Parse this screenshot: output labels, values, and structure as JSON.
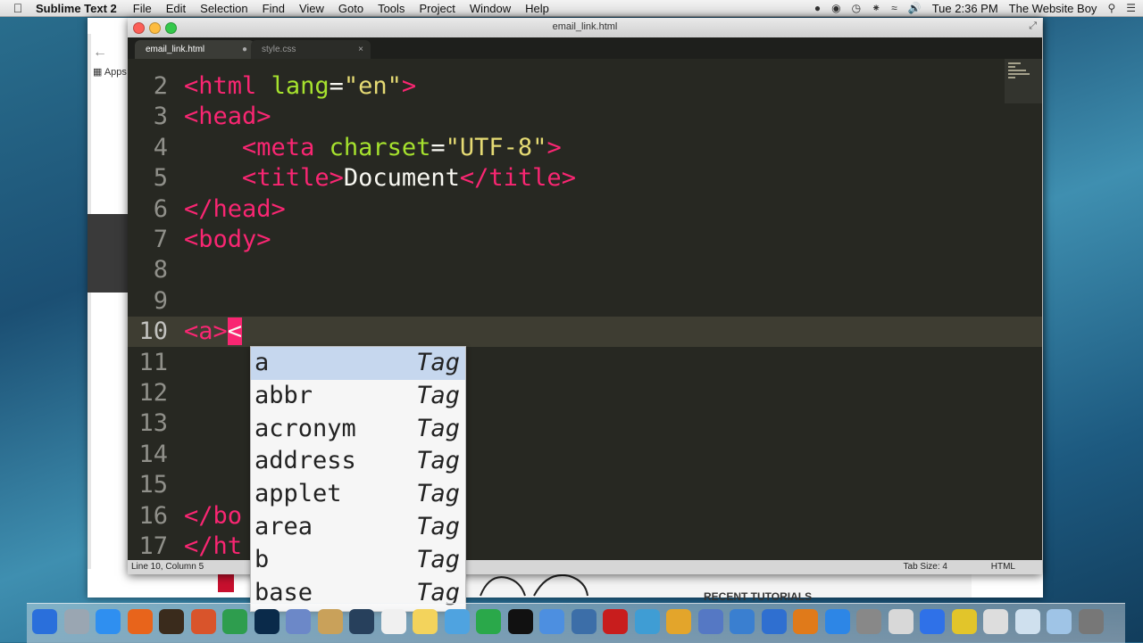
{
  "menubar": {
    "app_name": "Sublime Text 2",
    "menus": [
      "File",
      "Edit",
      "Selection",
      "Find",
      "View",
      "Goto",
      "Tools",
      "Project",
      "Window",
      "Help"
    ],
    "clock": "Tue 2:36 PM",
    "user": "The Website Boy"
  },
  "browser": {
    "apps_label": "Apps",
    "recent_tutorials": "RECENT TUTORIALS"
  },
  "window": {
    "title": "email_link.html"
  },
  "tabs": [
    {
      "label": "email_link.html",
      "active": true
    },
    {
      "label": "style.css",
      "active": false
    }
  ],
  "editor": {
    "lines": [
      {
        "num": "2",
        "tokens": [
          [
            "tag",
            "<"
          ],
          [
            "tag",
            "html"
          ],
          [
            "txt",
            " "
          ],
          [
            "attr",
            "lang"
          ],
          [
            "txt",
            "="
          ],
          [
            "str",
            "\"en\""
          ],
          [
            "tag",
            ">"
          ]
        ]
      },
      {
        "num": "3",
        "tokens": [
          [
            "tag",
            "<"
          ],
          [
            "tag",
            "head"
          ],
          [
            "tag",
            ">"
          ]
        ]
      },
      {
        "num": "4",
        "tokens": [
          [
            "txt",
            "    "
          ],
          [
            "tag",
            "<"
          ],
          [
            "tag",
            "meta"
          ],
          [
            "txt",
            " "
          ],
          [
            "attr",
            "charset"
          ],
          [
            "txt",
            "="
          ],
          [
            "str",
            "\"UTF-8\""
          ],
          [
            "tag",
            ">"
          ]
        ]
      },
      {
        "num": "5",
        "tokens": [
          [
            "txt",
            "    "
          ],
          [
            "tag",
            "<"
          ],
          [
            "tag",
            "title"
          ],
          [
            "tag",
            ">"
          ],
          [
            "txt",
            "Document"
          ],
          [
            "tag",
            "</"
          ],
          [
            "tag",
            "title"
          ],
          [
            "tag",
            ">"
          ]
        ]
      },
      {
        "num": "6",
        "tokens": [
          [
            "tag",
            "</"
          ],
          [
            "tag",
            "head"
          ],
          [
            "tag",
            ">"
          ]
        ]
      },
      {
        "num": "7",
        "tokens": [
          [
            "tag",
            "<"
          ],
          [
            "tag",
            "body"
          ],
          [
            "tag",
            ">"
          ]
        ]
      },
      {
        "num": "8",
        "tokens": []
      },
      {
        "num": "9",
        "tokens": []
      },
      {
        "num": "10",
        "tokens": [
          [
            "tag",
            "<"
          ],
          [
            "tag",
            "a"
          ],
          [
            "tag",
            ">"
          ],
          [
            "cursor-lt",
            "<"
          ]
        ],
        "current": true
      },
      {
        "num": "11",
        "tokens": []
      },
      {
        "num": "12",
        "tokens": []
      },
      {
        "num": "13",
        "tokens": []
      },
      {
        "num": "14",
        "tokens": []
      },
      {
        "num": "15",
        "tokens": []
      },
      {
        "num": "16",
        "tokens": [
          [
            "tag",
            "</"
          ],
          [
            "tag",
            "bo"
          ]
        ]
      },
      {
        "num": "17",
        "tokens": [
          [
            "tag",
            "</"
          ],
          [
            "tag",
            "ht"
          ]
        ]
      }
    ]
  },
  "autocomplete": {
    "items": [
      {
        "word": "a",
        "kind": "Tag",
        "selected": true
      },
      {
        "word": "abbr",
        "kind": "Tag"
      },
      {
        "word": "acronym",
        "kind": "Tag"
      },
      {
        "word": "address",
        "kind": "Tag"
      },
      {
        "word": "applet",
        "kind": "Tag"
      },
      {
        "word": "area",
        "kind": "Tag"
      },
      {
        "word": "b",
        "kind": "Tag"
      },
      {
        "word": "base",
        "kind": "Tag"
      }
    ]
  },
  "statusbar": {
    "position": "Line 10, Column 5",
    "tab_size": "Tab Size: 4",
    "syntax": "HTML"
  },
  "colors": {
    "editor_bg": "#272822",
    "tag": "#f92672",
    "attribute": "#a6e22e",
    "string": "#e6db74",
    "text": "#f8f8f2"
  }
}
